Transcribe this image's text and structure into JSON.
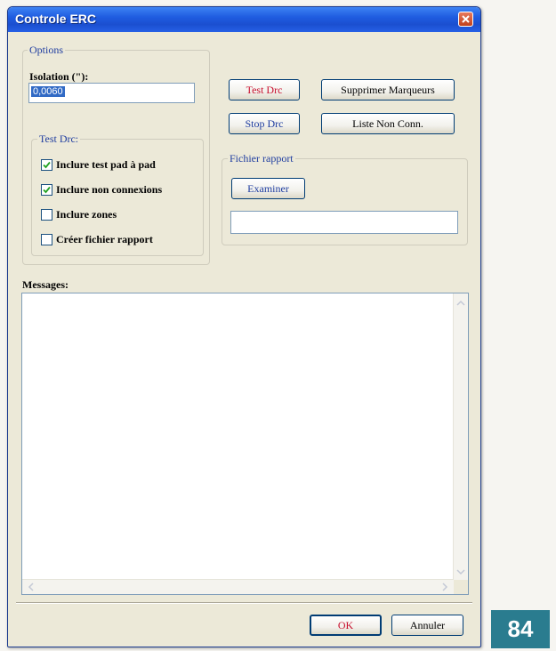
{
  "window": {
    "title": "Controle ERC"
  },
  "options": {
    "group_label": "Options",
    "isolation_label": "Isolation (\"):",
    "isolation_value": "0,0060"
  },
  "test_drc_group": {
    "group_label": "Test Drc:",
    "items": [
      {
        "label": "Inclure test pad à pad",
        "checked": true
      },
      {
        "label": "Inclure non connexions",
        "checked": true
      },
      {
        "label": "Inclure zones",
        "checked": false
      },
      {
        "label": "Créer fichier rapport",
        "checked": false
      }
    ]
  },
  "buttons": {
    "test_drc": "Test Drc",
    "supprimer_marqueurs": "Supprimer Marqueurs",
    "stop_drc": "Stop Drc",
    "liste_non_conn": "Liste Non Conn."
  },
  "fichier_rapport": {
    "group_label": "Fichier rapport",
    "examiner": "Examiner",
    "path_value": ""
  },
  "messages": {
    "label": "Messages:",
    "content": ""
  },
  "footer": {
    "ok": "OK",
    "annuler": "Annuler"
  },
  "page_number": "84",
  "colors": {
    "title_bar": "#1f5ce0",
    "accent_red": "#c8102e",
    "badge": "#2a7c8f"
  }
}
